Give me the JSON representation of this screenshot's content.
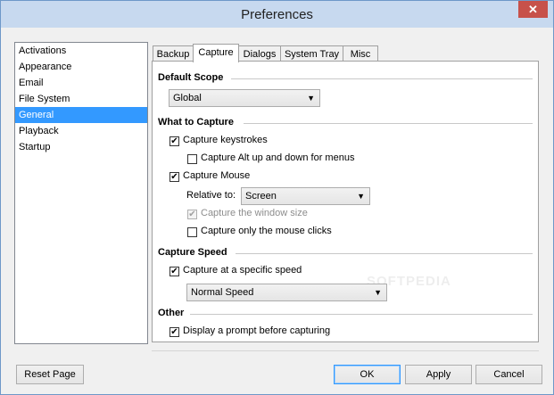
{
  "window": {
    "title": "Preferences",
    "close_glyph": "✕"
  },
  "sidebar": {
    "items": [
      {
        "label": "Activations"
      },
      {
        "label": "Appearance"
      },
      {
        "label": "Email"
      },
      {
        "label": "File System"
      },
      {
        "label": "General",
        "selected": true
      },
      {
        "label": "Playback"
      },
      {
        "label": "Startup"
      }
    ]
  },
  "tabs": [
    {
      "label": "Backup"
    },
    {
      "label": "Capture",
      "active": true
    },
    {
      "label": "Dialogs"
    },
    {
      "label": "System Tray"
    },
    {
      "label": "Misc"
    }
  ],
  "capture": {
    "default_scope": {
      "heading": "Default Scope",
      "value": "Global"
    },
    "what_to_capture": {
      "heading": "What to Capture",
      "capture_keystrokes": {
        "label": "Capture keystrokes",
        "checked": true
      },
      "capture_alt": {
        "label": "Capture Alt up and down for menus",
        "checked": false
      },
      "capture_mouse": {
        "label": "Capture Mouse",
        "checked": true
      },
      "relative_to": {
        "label": "Relative to:",
        "value": "Screen"
      },
      "capture_window_size": {
        "label": "Capture the window size",
        "checked": true,
        "disabled": true
      },
      "capture_mouse_clicks": {
        "label": "Capture only the mouse clicks",
        "checked": false
      }
    },
    "capture_speed": {
      "heading": "Capture Speed",
      "specific_speed": {
        "label": "Capture at a specific speed",
        "checked": true
      },
      "speed_value": "Normal Speed"
    },
    "other": {
      "heading": "Other",
      "display_prompt": {
        "label": "Display a prompt before capturing",
        "checked": true
      }
    }
  },
  "watermark": "SOFTPEDIA",
  "buttons": {
    "reset": "Reset Page",
    "ok": "OK",
    "apply": "Apply",
    "cancel": "Cancel"
  },
  "glyphs": {
    "check": "✔",
    "dropdown": "▼"
  }
}
